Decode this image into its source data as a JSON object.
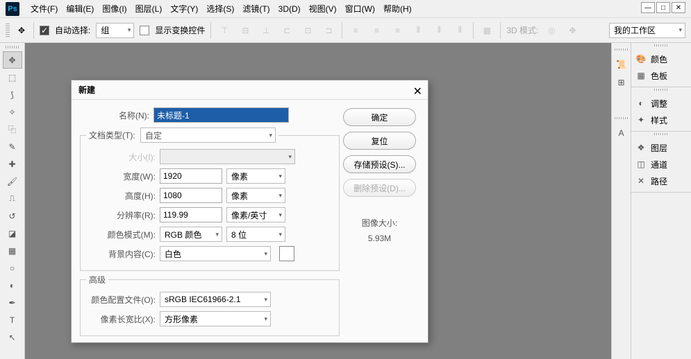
{
  "menubar": {
    "items": [
      "文件(F)",
      "编辑(E)",
      "图像(I)",
      "图层(L)",
      "文字(Y)",
      "选择(S)",
      "滤镜(T)",
      "3D(D)",
      "视图(V)",
      "窗口(W)",
      "帮助(H)"
    ]
  },
  "optionsbar": {
    "auto_select_label": "自动选择:",
    "auto_select_group": "组",
    "show_transform_label": "显示变换控件",
    "mode3d_label": "3D 模式:",
    "workspace": "我的工作区"
  },
  "panels": {
    "color": "颜色",
    "swatches": "色板",
    "adjustments": "调整",
    "styles": "样式",
    "layers": "图层",
    "channels": "通道",
    "paths": "路径"
  },
  "dialog": {
    "title": "新建",
    "name_label": "名称(N):",
    "name_value": "未标题-1",
    "preset_label": "文档类型(T):",
    "preset_value": "自定",
    "size_label": "大小(I):",
    "width_label": "宽度(W):",
    "width_value": "1920",
    "width_unit": "像素",
    "height_label": "高度(H):",
    "height_value": "1080",
    "height_unit": "像素",
    "res_label": "分辨率(R):",
    "res_value": "119.99",
    "res_unit": "像素/英寸",
    "mode_label": "颜色模式(M):",
    "mode_value": "RGB 颜色",
    "depth_value": "8 位",
    "bg_label": "背景内容(C):",
    "bg_value": "白色",
    "advanced_label": "高级",
    "profile_label": "颜色配置文件(O):",
    "profile_value": "sRGB IEC61966-2.1",
    "aspect_label": "像素长宽比(X):",
    "aspect_value": "方形像素",
    "ok": "确定",
    "cancel": "复位",
    "save_preset": "存储预设(S)...",
    "delete_preset": "删除预设(D)...",
    "img_size_label": "图像大小:",
    "img_size_value": "5.93M"
  }
}
